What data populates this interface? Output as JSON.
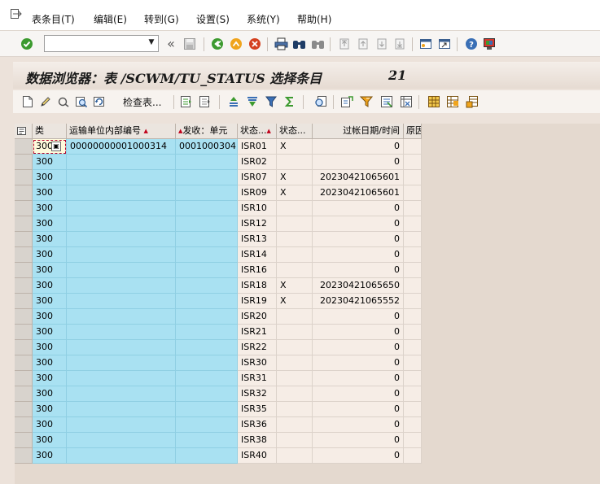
{
  "menu": {
    "items": [
      {
        "label": "表条目(T)",
        "name": "menu-table-entry"
      },
      {
        "label": "编辑(E)",
        "name": "menu-edit"
      },
      {
        "label": "转到(G)",
        "name": "menu-goto"
      },
      {
        "label": "设置(S)",
        "name": "menu-settings"
      },
      {
        "label": "系统(Y)",
        "name": "menu-system"
      },
      {
        "label": "帮助(H)",
        "name": "menu-help"
      }
    ]
  },
  "command_field": {
    "value": "",
    "placeholder": ""
  },
  "title": {
    "text": "数据浏览器：表 /SCWM/TU_STATUS 选择条目",
    "count": "21"
  },
  "app_toolbar": {
    "check_table_label": "检查表..."
  },
  "grid": {
    "headers": [
      {
        "label": "类",
        "sorted": false
      },
      {
        "label": "运输单位内部编号",
        "sorted": true
      },
      {
        "label": "发收：单元",
        "sorted": true
      },
      {
        "label": "状态...",
        "sorted": true
      },
      {
        "label": "状态...",
        "sorted": false
      },
      {
        "label": "过帐日期/时间",
        "sorted": false
      },
      {
        "label": "原因",
        "sorted": false
      }
    ],
    "rows": [
      {
        "cls": "300",
        "tu": "00000000001000314",
        "party": "0001000304",
        "status": "ISR01",
        "flag": "X",
        "posted": "0",
        "reason": ""
      },
      {
        "cls": "300",
        "tu": "",
        "party": "",
        "status": "ISR02",
        "flag": "",
        "posted": "0",
        "reason": ""
      },
      {
        "cls": "300",
        "tu": "",
        "party": "",
        "status": "ISR07",
        "flag": "X",
        "posted": "20230421065601",
        "reason": ""
      },
      {
        "cls": "300",
        "tu": "",
        "party": "",
        "status": "ISR09",
        "flag": "X",
        "posted": "20230421065601",
        "reason": ""
      },
      {
        "cls": "300",
        "tu": "",
        "party": "",
        "status": "ISR10",
        "flag": "",
        "posted": "0",
        "reason": ""
      },
      {
        "cls": "300",
        "tu": "",
        "party": "",
        "status": "ISR12",
        "flag": "",
        "posted": "0",
        "reason": ""
      },
      {
        "cls": "300",
        "tu": "",
        "party": "",
        "status": "ISR13",
        "flag": "",
        "posted": "0",
        "reason": ""
      },
      {
        "cls": "300",
        "tu": "",
        "party": "",
        "status": "ISR14",
        "flag": "",
        "posted": "0",
        "reason": ""
      },
      {
        "cls": "300",
        "tu": "",
        "party": "",
        "status": "ISR16",
        "flag": "",
        "posted": "0",
        "reason": ""
      },
      {
        "cls": "300",
        "tu": "",
        "party": "",
        "status": "ISR18",
        "flag": "X",
        "posted": "20230421065650",
        "reason": ""
      },
      {
        "cls": "300",
        "tu": "",
        "party": "",
        "status": "ISR19",
        "flag": "X",
        "posted": "20230421065552",
        "reason": ""
      },
      {
        "cls": "300",
        "tu": "",
        "party": "",
        "status": "ISR20",
        "flag": "",
        "posted": "0",
        "reason": ""
      },
      {
        "cls": "300",
        "tu": "",
        "party": "",
        "status": "ISR21",
        "flag": "",
        "posted": "0",
        "reason": ""
      },
      {
        "cls": "300",
        "tu": "",
        "party": "",
        "status": "ISR22",
        "flag": "",
        "posted": "0",
        "reason": ""
      },
      {
        "cls": "300",
        "tu": "",
        "party": "",
        "status": "ISR30",
        "flag": "",
        "posted": "0",
        "reason": ""
      },
      {
        "cls": "300",
        "tu": "",
        "party": "",
        "status": "ISR31",
        "flag": "",
        "posted": "0",
        "reason": ""
      },
      {
        "cls": "300",
        "tu": "",
        "party": "",
        "status": "ISR32",
        "flag": "",
        "posted": "0",
        "reason": ""
      },
      {
        "cls": "300",
        "tu": "",
        "party": "",
        "status": "ISR35",
        "flag": "",
        "posted": "0",
        "reason": ""
      },
      {
        "cls": "300",
        "tu": "",
        "party": "",
        "status": "ISR36",
        "flag": "",
        "posted": "0",
        "reason": ""
      },
      {
        "cls": "300",
        "tu": "",
        "party": "",
        "status": "ISR38",
        "flag": "",
        "posted": "0",
        "reason": ""
      },
      {
        "cls": "300",
        "tu": "",
        "party": "",
        "status": "ISR40",
        "flag": "",
        "posted": "0",
        "reason": ""
      }
    ]
  },
  "colors": {
    "key_column": "#a9e1f2",
    "normal_cell": "#f6ede6",
    "background": "#ece2da",
    "sort_marker": "#c0001a"
  },
  "icons": {
    "standard_toolbar": [
      "enter-icon",
      "back-icon",
      "save-icon",
      "back-green-icon",
      "exit-icon",
      "cancel-icon",
      "print-icon",
      "find-icon",
      "find-next-icon",
      "first-page-icon",
      "previous-page-icon",
      "next-page-icon",
      "last-page-icon",
      "new-session-icon",
      "shortcut-icon",
      "help-icon",
      "customize-layout-icon"
    ],
    "application_toolbar": [
      "new-entry-icon",
      "change-icon",
      "check-icon",
      "display-icon",
      "refresh-icon",
      "detail-icon",
      "select-all-icon",
      "sort-ascending-icon",
      "filter-icon",
      "filter-funnel-icon",
      "sum-icon",
      "print-preview-icon",
      "export-icon",
      "find-icon",
      "layout-icon",
      "change-layout-icon",
      "select-layout-icon"
    ]
  }
}
